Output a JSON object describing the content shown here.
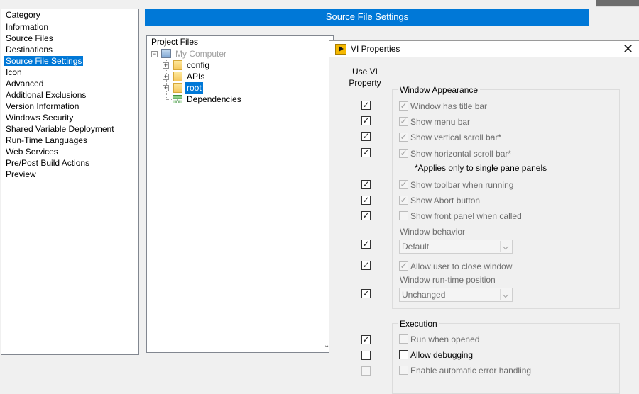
{
  "category": {
    "header": "Category",
    "items": [
      {
        "label": "Information",
        "selected": false
      },
      {
        "label": "Source Files",
        "selected": false
      },
      {
        "label": "Destinations",
        "selected": false
      },
      {
        "label": "Source File Settings",
        "selected": true
      },
      {
        "label": "Icon",
        "selected": false
      },
      {
        "label": "Advanced",
        "selected": false
      },
      {
        "label": "Additional Exclusions",
        "selected": false
      },
      {
        "label": "Version Information",
        "selected": false
      },
      {
        "label": "Windows Security",
        "selected": false
      },
      {
        "label": "Shared Variable Deployment",
        "selected": false
      },
      {
        "label": "Run-Time Languages",
        "selected": false
      },
      {
        "label": "Web Services",
        "selected": false
      },
      {
        "label": "Pre/Post Build Actions",
        "selected": false
      },
      {
        "label": "Preview",
        "selected": false
      }
    ]
  },
  "banner": {
    "title": "Source File Settings"
  },
  "project_files": {
    "header": "Project Files",
    "tree": {
      "root": "My Computer",
      "items": [
        {
          "label": "config",
          "icon": "folder-icon"
        },
        {
          "label": "APIs",
          "icon": "folder-icon"
        },
        {
          "label": "root",
          "icon": "folder-icon",
          "selected": true
        },
        {
          "label": "Dependencies",
          "icon": "dependencies-icon"
        }
      ]
    }
  },
  "dialog": {
    "title": "VI Properties",
    "close_glyph": "✕",
    "use_vi_property_header": "Use VI Property",
    "window_appearance": {
      "title": "Window Appearance",
      "options": [
        {
          "label": "Window has title bar",
          "use_vi": true,
          "checked": true,
          "enabled": false
        },
        {
          "label": "Show menu bar",
          "use_vi": true,
          "checked": true,
          "enabled": false
        },
        {
          "label": "Show vertical scroll bar*",
          "use_vi": true,
          "checked": true,
          "enabled": false
        },
        {
          "label": "Show horizontal scroll bar*",
          "use_vi": true,
          "checked": true,
          "enabled": false
        },
        {
          "label": "Show toolbar when running",
          "use_vi": true,
          "checked": true,
          "enabled": false
        },
        {
          "label": "Show Abort button",
          "use_vi": true,
          "checked": true,
          "enabled": false
        },
        {
          "label": "Show front panel when called",
          "use_vi": true,
          "checked": false,
          "enabled": false
        },
        {
          "label": "Allow user to close window",
          "use_vi": true,
          "checked": true,
          "enabled": false
        }
      ],
      "note": "*Applies only to single pane panels",
      "window_behavior": {
        "label": "Window behavior",
        "value": "Default",
        "use_vi": true
      },
      "window_runtime_position": {
        "label": "Window run-time position",
        "value": "Unchanged",
        "use_vi": true
      }
    },
    "execution": {
      "title": "Execution",
      "options": [
        {
          "label": "Run when opened",
          "use_vi": true,
          "checked": false,
          "enabled": false
        },
        {
          "label": "Allow debugging",
          "use_vi": false,
          "checked": false,
          "enabled": true
        },
        {
          "label": "Enable automatic error handling",
          "use_vi": false,
          "checked": false,
          "enabled": false
        }
      ]
    }
  },
  "colors": {
    "accent": "#0078d7",
    "disabled_text": "#6d6d6d"
  },
  "glyphs": {
    "check": "✓",
    "expand": "+",
    "collapse": "−",
    "scroll_down": "⌄"
  }
}
